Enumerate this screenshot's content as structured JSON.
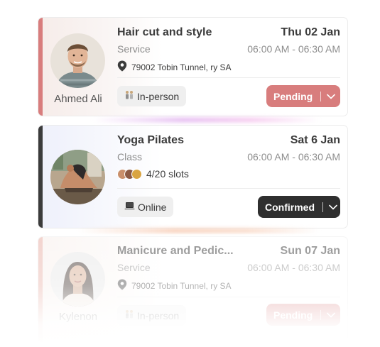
{
  "bookings": [
    {
      "title": "Hair cut and style",
      "date": "Thu 02 Jan",
      "type": "Service",
      "time": "06:00 AM - 06:30 AM",
      "address": "79002 Tobin Tunnel, ry SA",
      "person": "Ahmed Ali",
      "mode": "In-person",
      "mode_icon": "people-icon",
      "status": "Pending",
      "status_color": "#d87d7d"
    },
    {
      "title": "Yoga Pilates",
      "date": "Sat 6 Jan",
      "type": "Class",
      "time": "06:00 AM - 06:30 AM",
      "slots": "4/20 slots",
      "mode": "Online",
      "mode_icon": "laptop-icon",
      "status": "Confirmed",
      "status_color": "#2f2f2f"
    },
    {
      "title": "Manicure and Pedic...",
      "date": "Sun 07 Jan",
      "type": "Service",
      "time": "06:00 AM - 06:30 AM",
      "address": "79002 Tobin Tunnel, ry SA",
      "person": "Kylenon",
      "mode": "In-person",
      "mode_icon": "people-icon",
      "status": "Pending",
      "status_color": "#d87d7d"
    }
  ],
  "colors": {
    "pending": "#d87d7d",
    "confirmed": "#2f2f2f",
    "text": "#3b3b3b",
    "muted": "#8e8e8e"
  }
}
